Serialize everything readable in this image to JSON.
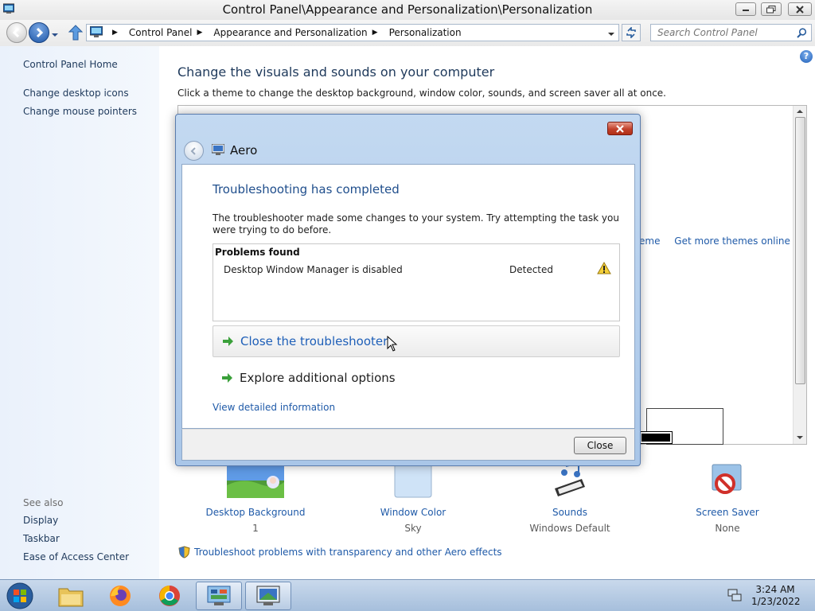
{
  "window": {
    "title": "Control Panel\\Appearance and Personalization\\Personalization"
  },
  "address": {
    "crumbs": [
      "Control Panel",
      "Appearance and Personalization",
      "Personalization"
    ],
    "search_placeholder": "Search Control Panel"
  },
  "sidebar": {
    "home": "Control Panel Home",
    "links": [
      "Change desktop icons",
      "Change mouse pointers"
    ],
    "see_also_heading": "See also",
    "see_also": [
      "Display",
      "Taskbar",
      "Ease of Access Center"
    ]
  },
  "main": {
    "heading": "Change the visuals and sounds on your computer",
    "subtitle": "Click a theme to change the desktop background, window color, sounds, and screen saver all at once.",
    "theme_links": [
      "eme",
      "Get more themes online"
    ],
    "items": [
      {
        "label": "Desktop Background",
        "value": "1",
        "icon": "desktop-background-icon"
      },
      {
        "label": "Window Color",
        "value": "Sky",
        "icon": "window-color-icon"
      },
      {
        "label": "Sounds",
        "value": "Windows Default",
        "icon": "sounds-icon"
      },
      {
        "label": "Screen Saver",
        "value": "None",
        "icon": "screen-saver-icon"
      }
    ],
    "troubleshoot_link": "Troubleshoot problems with transparency and other Aero effects"
  },
  "dialog": {
    "title": "Aero",
    "heading": "Troubleshooting has completed",
    "description": "The troubleshooter made some changes to your system. Try attempting the task you were trying to do before.",
    "problems_header": "Problems found",
    "problems": [
      {
        "name": "Desktop Window Manager is disabled",
        "status": "Detected",
        "icon": "warning-icon"
      }
    ],
    "options": [
      "Close the troubleshooter",
      "Explore additional options"
    ],
    "detail_link": "View detailed information",
    "close_button": "Close"
  },
  "taskbar": {
    "apps": [
      "start-orb",
      "file-explorer",
      "firefox",
      "chrome",
      "control-panel",
      "personalization-window"
    ],
    "time": "3:24 AM",
    "date": "1/23/2022"
  },
  "colors": {
    "link": "#1f5aa8",
    "heading": "#1e395b",
    "dialog_frame": "#a9c6e8",
    "sidebar_bg": "#eaf1fb"
  }
}
